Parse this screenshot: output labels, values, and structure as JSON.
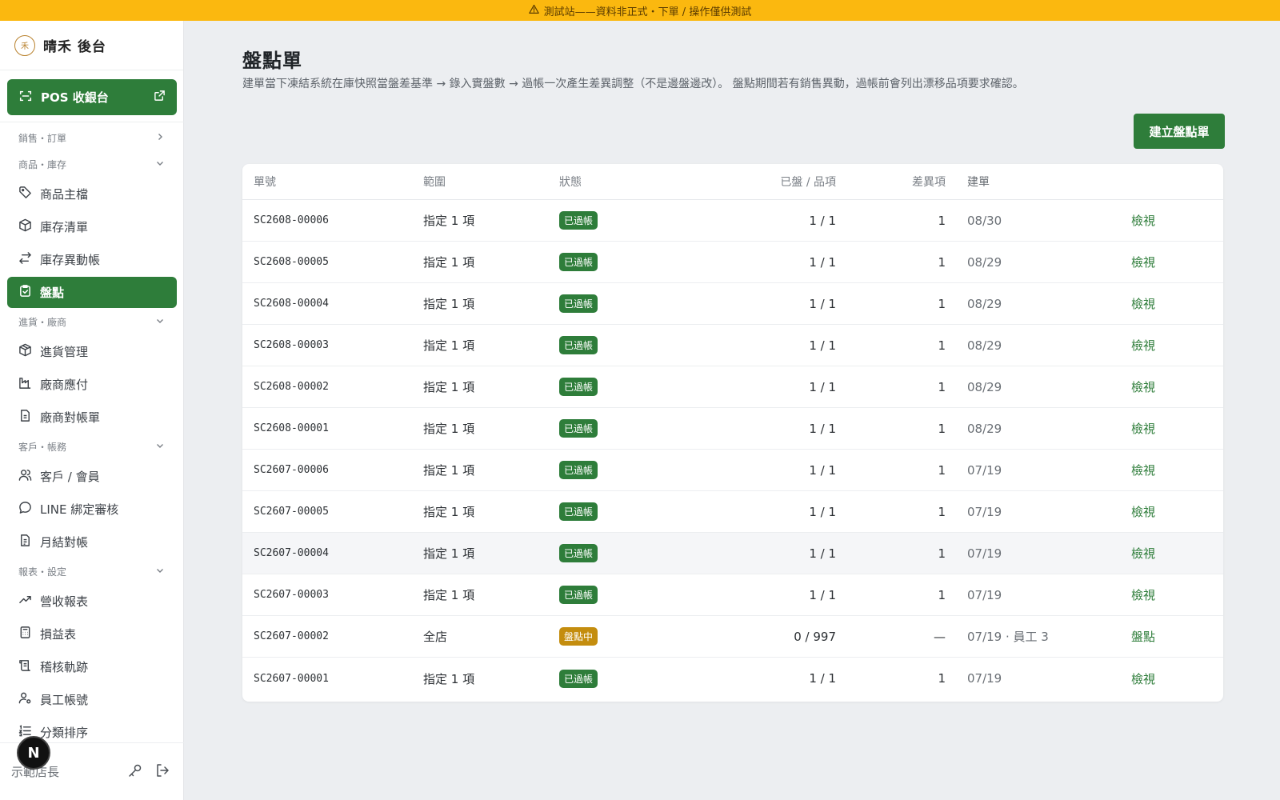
{
  "banner": {
    "text": "測試站——資料非正式・下單 / 操作僅供測試",
    "icon": "warning-icon"
  },
  "brand": {
    "logo_char": "禾",
    "name": "晴禾 後台"
  },
  "pos_button": {
    "label": "POS 收銀台"
  },
  "nav": {
    "groups": [
      {
        "label": "銷售・訂單"
      },
      {
        "label": "商品・庫存"
      },
      {
        "label": "進貨・廠商"
      },
      {
        "label": "客戶・帳務"
      },
      {
        "label": "報表・設定"
      }
    ],
    "items": [
      {
        "label": "商品主檔"
      },
      {
        "label": "庫存清單"
      },
      {
        "label": "庫存異動帳"
      },
      {
        "label": "盤點"
      },
      {
        "label": "進貨管理"
      },
      {
        "label": "廠商應付"
      },
      {
        "label": "廠商對帳單"
      },
      {
        "label": "客戶 / 會員"
      },
      {
        "label": "LINE 綁定審核"
      },
      {
        "label": "月結對帳"
      },
      {
        "label": "營收報表"
      },
      {
        "label": "損益表"
      },
      {
        "label": "稽核軌跡"
      },
      {
        "label": "員工帳號"
      },
      {
        "label": "分類排序"
      }
    ]
  },
  "footer": {
    "user": "示範店長",
    "badge": "N"
  },
  "page": {
    "title": "盤點單",
    "description": "建單當下凍結系統在庫快照當盤差基準 → 錄入實盤數 → 過帳一次產生差異調整（不是邊盤邊改）。 盤點期間若有銷售異動，過帳前會列出漂移品項要求確認。",
    "create_button": "建立盤點單"
  },
  "table": {
    "headers": {
      "id": "單號",
      "scope": "範圍",
      "status": "狀態",
      "count": "已盤 / 品項",
      "diff": "差異項",
      "created": "建單"
    },
    "rows": [
      {
        "id": "SC2608-00006",
        "scope": "指定 1 項",
        "status": "已過帳",
        "count": "1 / 1",
        "diff": "1",
        "created": "08/30",
        "action": "檢視"
      },
      {
        "id": "SC2608-00005",
        "scope": "指定 1 項",
        "status": "已過帳",
        "count": "1 / 1",
        "diff": "1",
        "created": "08/29",
        "action": "檢視"
      },
      {
        "id": "SC2608-00004",
        "scope": "指定 1 項",
        "status": "已過帳",
        "count": "1 / 1",
        "diff": "1",
        "created": "08/29",
        "action": "檢視"
      },
      {
        "id": "SC2608-00003",
        "scope": "指定 1 項",
        "status": "已過帳",
        "count": "1 / 1",
        "diff": "1",
        "created": "08/29",
        "action": "檢視"
      },
      {
        "id": "SC2608-00002",
        "scope": "指定 1 項",
        "status": "已過帳",
        "count": "1 / 1",
        "diff": "1",
        "created": "08/29",
        "action": "檢視"
      },
      {
        "id": "SC2608-00001",
        "scope": "指定 1 項",
        "status": "已過帳",
        "count": "1 / 1",
        "diff": "1",
        "created": "08/29",
        "action": "檢視"
      },
      {
        "id": "SC2607-00006",
        "scope": "指定 1 項",
        "status": "已過帳",
        "count": "1 / 1",
        "diff": "1",
        "created": "07/19",
        "action": "檢視"
      },
      {
        "id": "SC2607-00005",
        "scope": "指定 1 項",
        "status": "已過帳",
        "count": "1 / 1",
        "diff": "1",
        "created": "07/19",
        "action": "檢視"
      },
      {
        "id": "SC2607-00004",
        "scope": "指定 1 項",
        "status": "已過帳",
        "count": "1 / 1",
        "diff": "1",
        "created": "07/19",
        "action": "檢視"
      },
      {
        "id": "SC2607-00003",
        "scope": "指定 1 項",
        "status": "已過帳",
        "count": "1 / 1",
        "diff": "1",
        "created": "07/19",
        "action": "檢視"
      },
      {
        "id": "SC2607-00002",
        "scope": "全店",
        "status": "盤點中",
        "count": "0 / 997",
        "diff": "—",
        "created": "07/19 · 員工 3",
        "action": "盤點"
      },
      {
        "id": "SC2607-00001",
        "scope": "指定 1 項",
        "status": "已過帳",
        "count": "1 / 1",
        "diff": "1",
        "created": "07/19",
        "action": "檢視"
      }
    ]
  },
  "colors": {
    "accent": "#2e7d3a",
    "banner": "#fbb80f",
    "pending": "#c48d0e"
  }
}
